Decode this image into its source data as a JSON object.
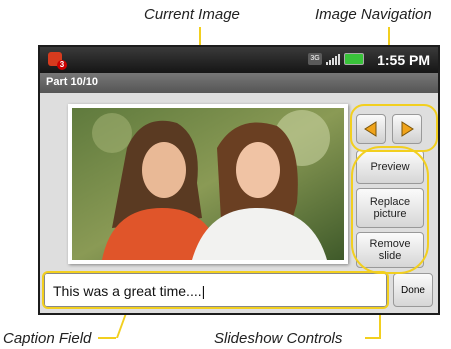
{
  "callouts": {
    "current_image": "Current Image",
    "image_navigation": "Image Navigation",
    "caption_field": "Caption Field",
    "slideshow_controls": "Slideshow Controls"
  },
  "status_bar": {
    "time": "1:55 PM",
    "network": "3G",
    "notification_badge": "3"
  },
  "title": "Part 10/10",
  "buttons": {
    "prev": "◀",
    "next": "▶",
    "preview": "Preview",
    "replace": "Replace picture",
    "remove": "Remove slide",
    "done": "Done"
  },
  "caption": {
    "value": "This was a great time....|"
  },
  "colors": {
    "highlight": "#f2cf1f",
    "nav_arrow": "#f0a31a",
    "battery": "#39c33a"
  }
}
